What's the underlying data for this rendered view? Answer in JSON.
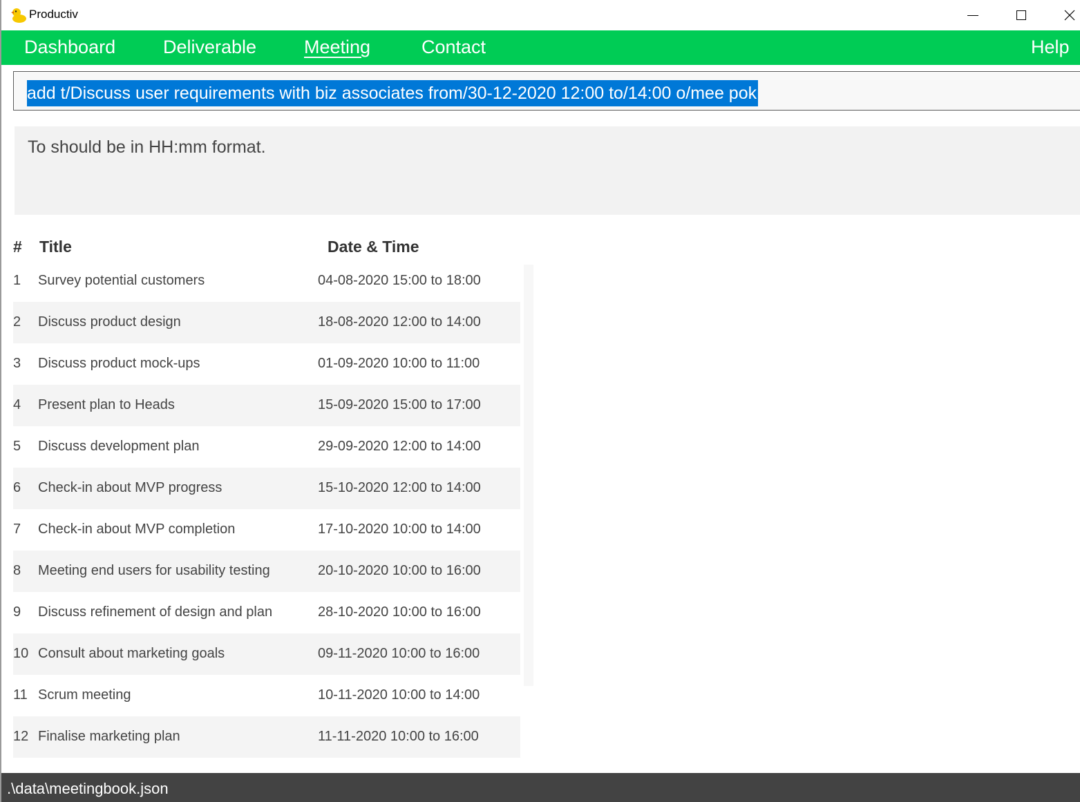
{
  "window": {
    "title": "Productiv",
    "icon": "rubber-duck-icon"
  },
  "menu": {
    "items": [
      {
        "label": "Dashboard"
      },
      {
        "label": "Deliverable"
      },
      {
        "label": "Meeting",
        "active": true
      },
      {
        "label": "Contact"
      }
    ],
    "help": "Help",
    "color": "#00cc55"
  },
  "command": {
    "value": "add t/Discuss user requirements with biz associates from/30-12-2020 12:00 to/14:00 o/mee pok",
    "selection_color": "#0078d7"
  },
  "result": {
    "message": "To should be in HH:mm format."
  },
  "table": {
    "headers": {
      "num": "#",
      "title": "Title",
      "date": "Date & Time"
    },
    "rows": [
      {
        "num": "1",
        "title": "Survey potential customers",
        "date": "04-08-2020 15:00 to 18:00"
      },
      {
        "num": "2",
        "title": "Discuss product design",
        "date": "18-08-2020 12:00 to 14:00"
      },
      {
        "num": "3",
        "title": "Discuss product mock-ups",
        "date": "01-09-2020 10:00 to 11:00"
      },
      {
        "num": "4",
        "title": "Present plan to Heads",
        "date": "15-09-2020 15:00 to 17:00"
      },
      {
        "num": "5",
        "title": "Discuss development plan",
        "date": "29-09-2020 12:00 to 14:00"
      },
      {
        "num": "6",
        "title": "Check-in about MVP progress",
        "date": "15-10-2020 12:00 to 14:00"
      },
      {
        "num": "7",
        "title": "Check-in about MVP completion",
        "date": "17-10-2020 10:00 to 14:00"
      },
      {
        "num": "8",
        "title": "Meeting end users for usability testing",
        "date": "20-10-2020 10:00 to 16:00"
      },
      {
        "num": "9",
        "title": "Discuss refinement of design and plan",
        "date": "28-10-2020 10:00 to 16:00"
      },
      {
        "num": "10",
        "title": "Consult about marketing goals",
        "date": "09-11-2020 10:00 to 16:00"
      },
      {
        "num": "11",
        "title": "Scrum meeting",
        "date": "10-11-2020 10:00 to 14:00"
      },
      {
        "num": "12",
        "title": "Finalise marketing plan",
        "date": "11-11-2020 10:00 to 16:00"
      }
    ]
  },
  "status": {
    "path": ".\\data\\meetingbook.json"
  }
}
